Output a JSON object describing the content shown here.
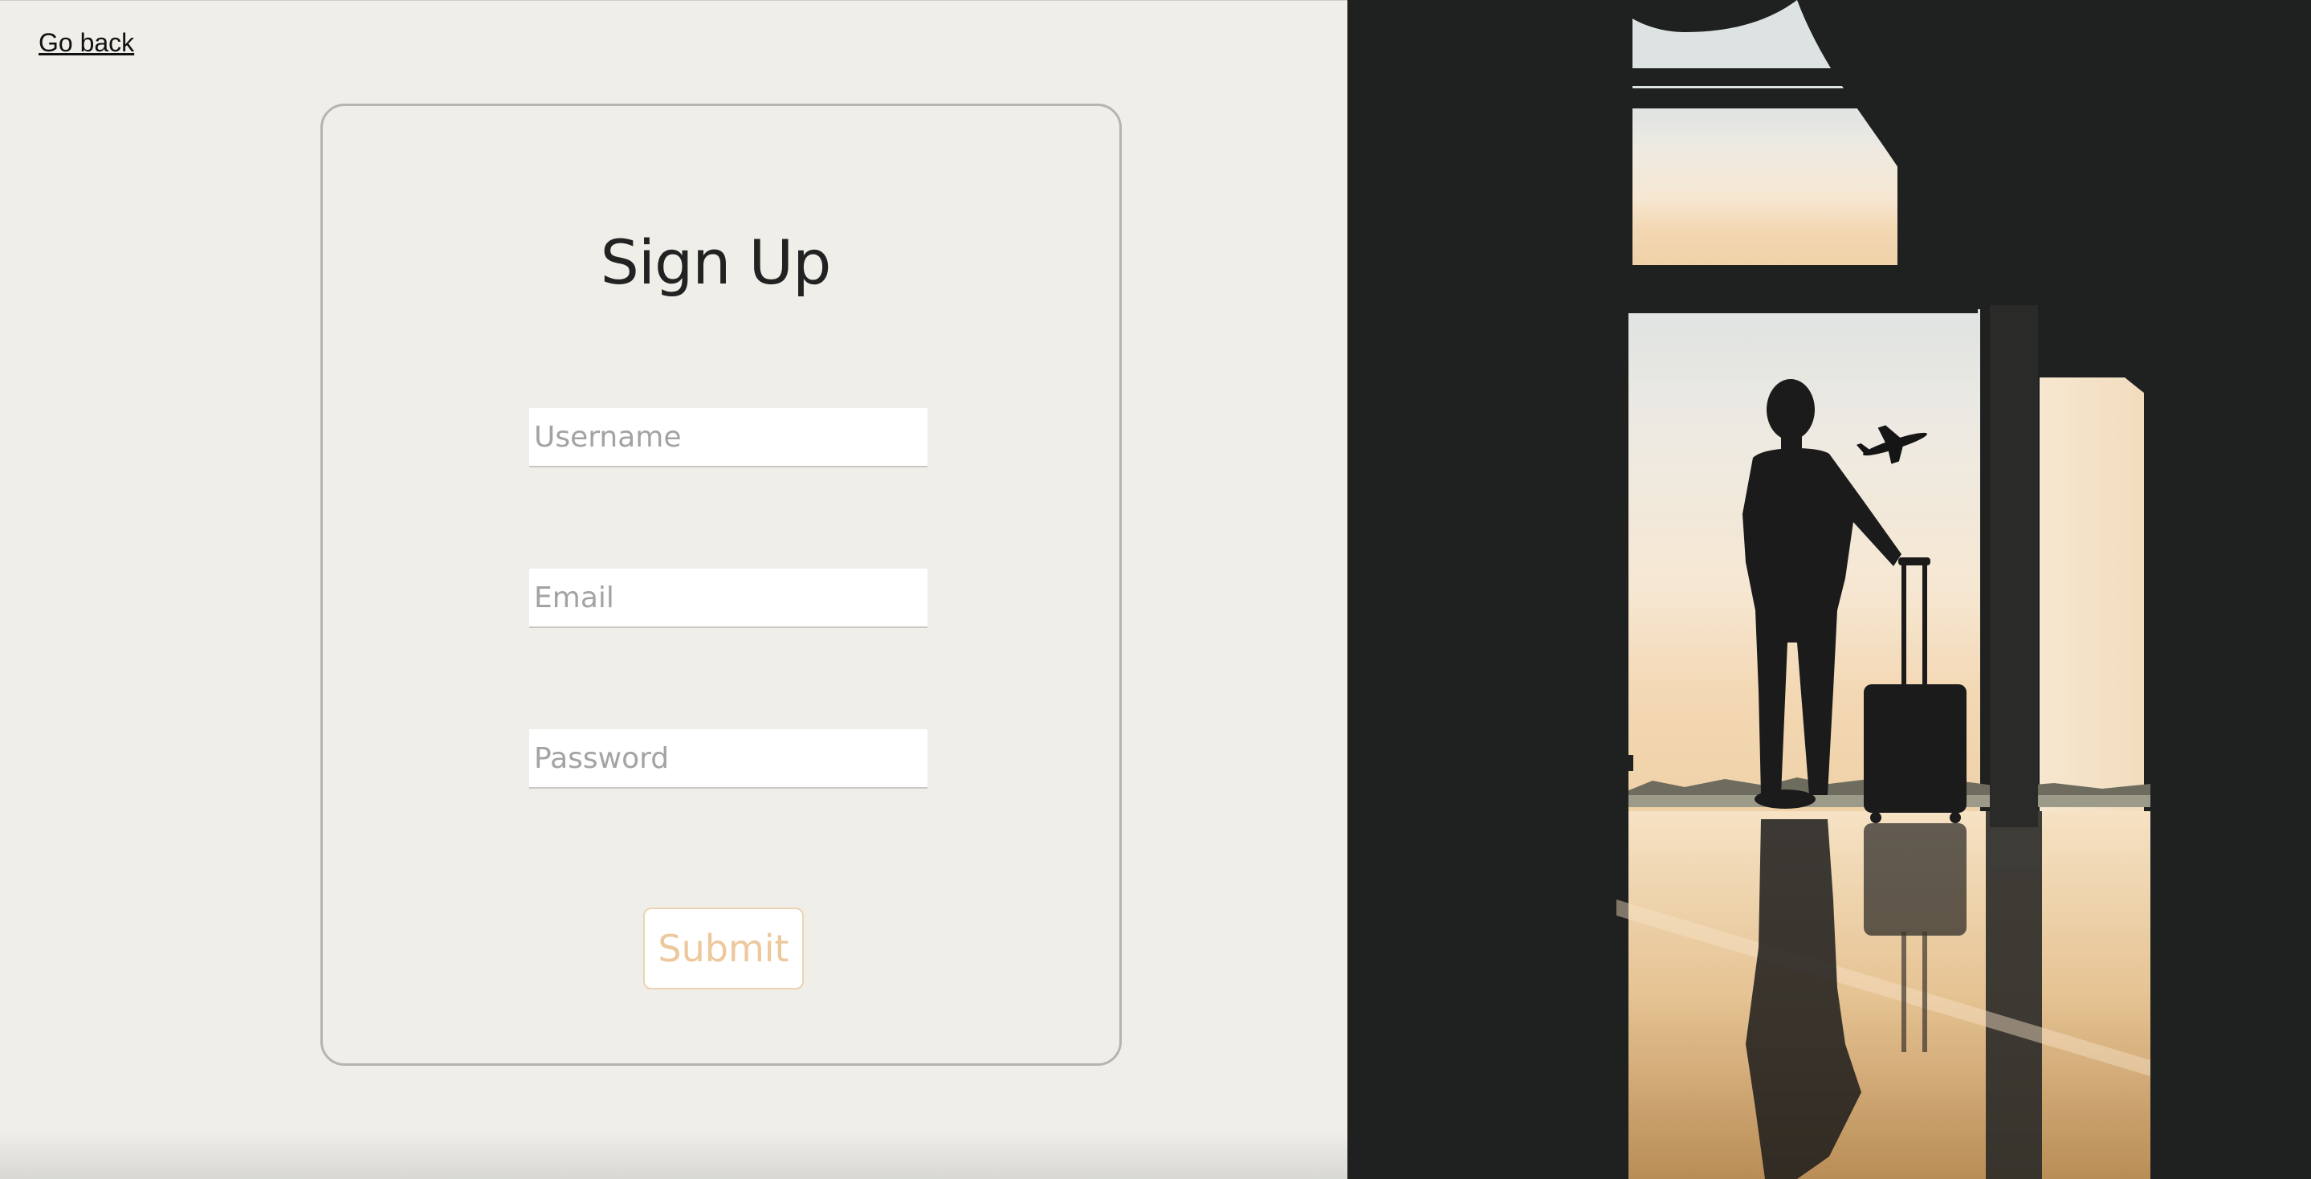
{
  "nav": {
    "go_back_label": "Go back"
  },
  "form": {
    "title": "Sign Up",
    "fields": {
      "username": {
        "placeholder": "Username",
        "value": ""
      },
      "email": {
        "placeholder": "Email",
        "value": ""
      },
      "password": {
        "placeholder": "Password",
        "value": ""
      }
    },
    "submit_label": "Submit"
  },
  "hero_image": {
    "subject": "silhouette-traveler-with-suitcase-airport-window"
  },
  "colors": {
    "background": "#efeee9",
    "card_border": "#b5b4b0",
    "title": "#222222",
    "submit_text": "#ecc89c",
    "submit_border": "#ecd3b1",
    "photo_dark": "#1f2020",
    "sky_warm": "#f3dcbc"
  }
}
